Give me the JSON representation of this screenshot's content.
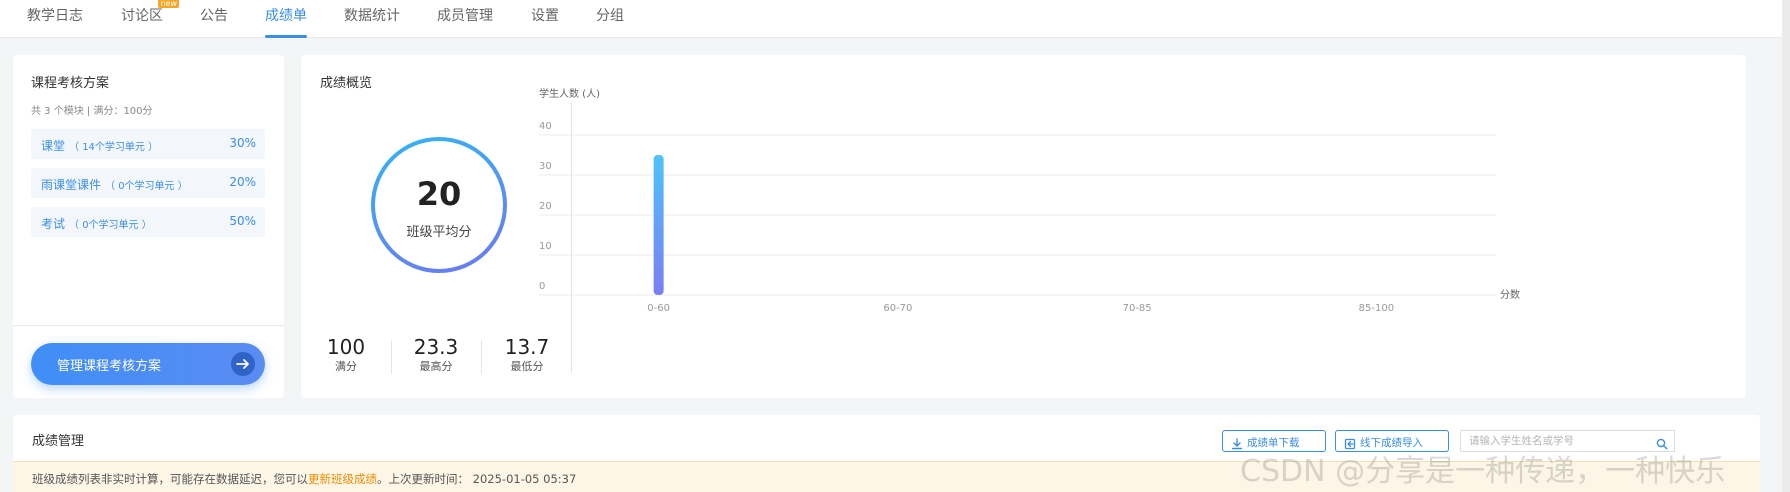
{
  "nav": {
    "tabs": [
      {
        "label": "教学日志"
      },
      {
        "label": "讨论区",
        "badge": "new"
      },
      {
        "label": "公告"
      },
      {
        "label": "成绩单",
        "active": true
      },
      {
        "label": "数据统计"
      },
      {
        "label": "成员管理"
      },
      {
        "label": "设置"
      },
      {
        "label": "分组"
      }
    ]
  },
  "scheme": {
    "title": "课程考核方案",
    "summary": "共 3 个模块 | 满分：100分",
    "modules": [
      {
        "name": "课堂",
        "units": "（ 14个学习单元 ）",
        "percent": "30%"
      },
      {
        "name": "雨课堂课件",
        "units": "（ 0个学习单元 ）",
        "percent": "20%"
      },
      {
        "name": "考试",
        "units": "（ 0个学习单元 ）",
        "percent": "50%"
      }
    ],
    "manage_button": "管理课程考核方案"
  },
  "overview": {
    "title": "成绩概览",
    "average": "20",
    "average_label": "班级平均分",
    "stats": [
      {
        "value": "100",
        "label": "满分"
      },
      {
        "value": "23.3",
        "label": "最高分"
      },
      {
        "value": "13.7",
        "label": "最低分"
      }
    ]
  },
  "chart_data": {
    "type": "bar",
    "ylabel": "学生人数 (人)",
    "xlabel": "分数",
    "categories": [
      "0-60",
      "60-70",
      "70-85",
      "85-100"
    ],
    "values": [
      35,
      0,
      0,
      0
    ],
    "ylim": [
      0,
      40
    ],
    "yticks": [
      0,
      10,
      20,
      30,
      40
    ],
    "grid": true,
    "colors": {
      "bar_top": "#4fc3f7",
      "bar_bottom": "#7b7ff2"
    }
  },
  "grades": {
    "title": "成绩管理",
    "download_button": "成绩单下载",
    "import_button": "线下成绩导入",
    "search_placeholder": "请输入学生姓名或学号",
    "notice_prefix": "班级成绩列表非实时计算，可能存在数据延迟，您可以",
    "notice_link": "更新班级成绩",
    "notice_suffix": "。上次更新时间： 2025-01-05 05:37"
  },
  "watermark": "CSDN @分享是一种传递，一种快乐"
}
